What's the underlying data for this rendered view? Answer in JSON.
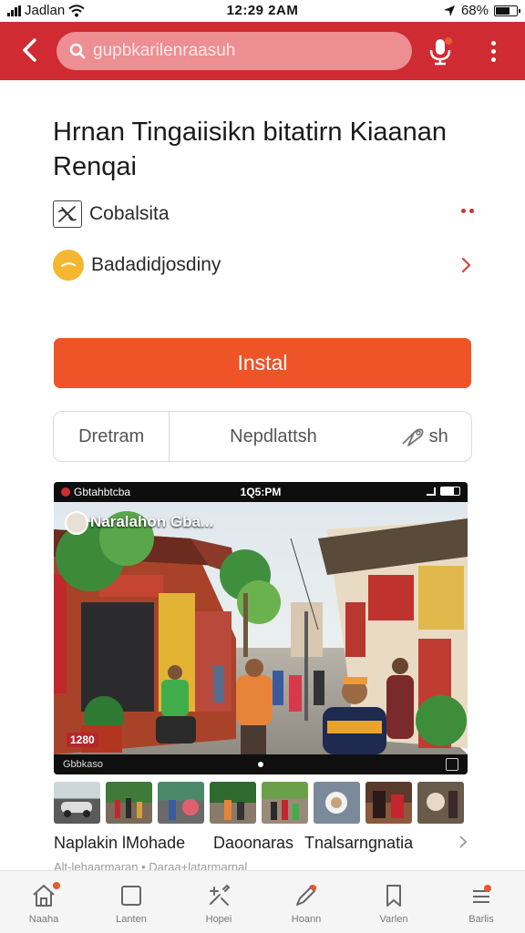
{
  "status_bar": {
    "carrier": "Jadlan",
    "time": "12:29 2AM",
    "battery": "68%",
    "battery_level": 0.68
  },
  "header": {
    "search_placeholder": "gupbkarilenraasuh",
    "back_icon": "back-arrow-icon",
    "mic_icon": "microphone-icon",
    "more_icon": "more-vertical-icon"
  },
  "app": {
    "title": "Hrnan Tingaiisikn bitatirn Kiaanan Renqai",
    "developer": "Cobalsita",
    "rating_text": "Badadidjosdiny",
    "install_label": "Instal"
  },
  "tabs": {
    "items": [
      "Dretram",
      "Nepdlattsh",
      "sh"
    ]
  },
  "preview": {
    "status_left": "Gbtahbtcba",
    "status_time": "1Q5:PM",
    "overlay_title": "Naralahon Gba...",
    "counter": "1280",
    "bottom_left": "Gbbkaso"
  },
  "thumbnails": {
    "count_shown": 8
  },
  "captions": {
    "items": [
      "Naplakin lMohade",
      "Daoonaras",
      "Tnalsarngnatia"
    ],
    "faded": "Alt-lehaarmaran • Daraa+latarmarnal"
  },
  "bottom_nav": {
    "items": [
      {
        "label": "Naaha",
        "icon": "home-icon"
      },
      {
        "label": "Lanten",
        "icon": "square-icon"
      },
      {
        "label": "Hopei",
        "icon": "tools-icon"
      },
      {
        "label": "Hoann",
        "icon": "pen-icon"
      },
      {
        "label": "Varlen",
        "icon": "bookmark-icon"
      },
      {
        "label": "Barlis",
        "icon": "menu-icon"
      }
    ]
  },
  "colors": {
    "header_red": "#d02a33",
    "install_orange": "#ee5428",
    "accent_red": "#c7343b",
    "coin_yellow": "#f5b731"
  }
}
